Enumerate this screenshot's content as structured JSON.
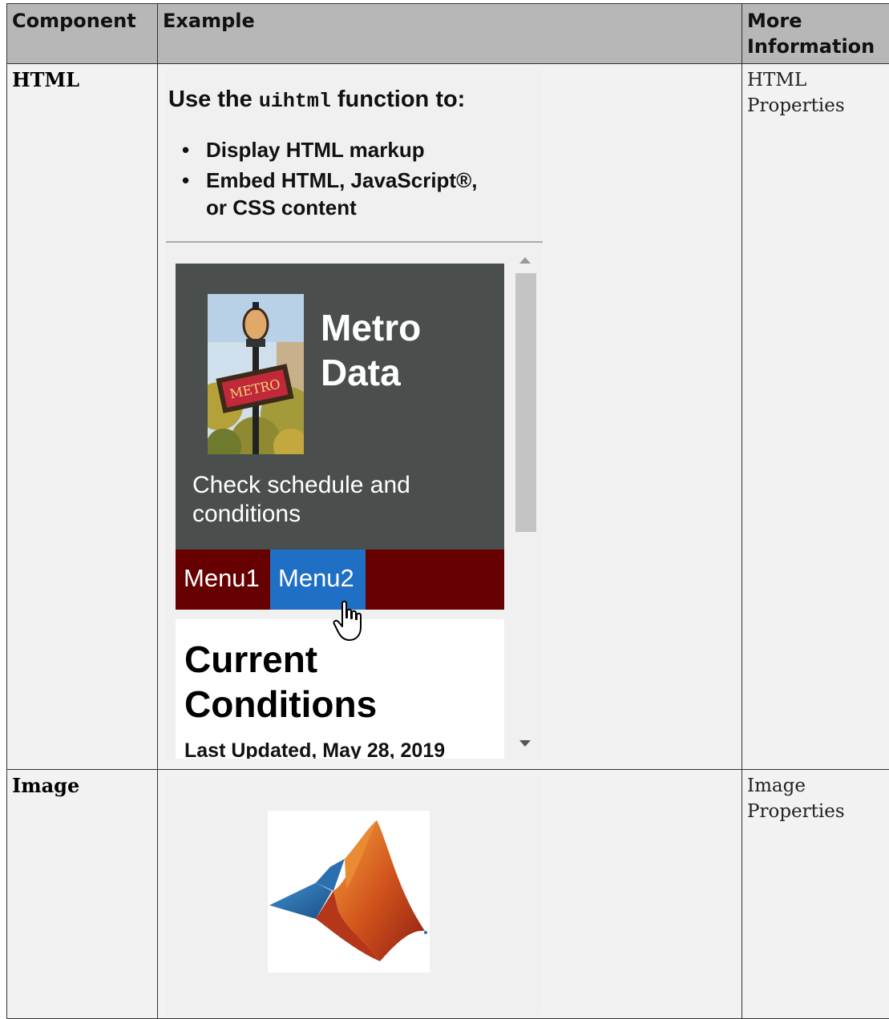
{
  "table": {
    "headers": {
      "component": "Component",
      "example": "Example",
      "more_info": "More Information"
    },
    "rows": [
      {
        "component": "HTML",
        "more_info": "HTML Properties"
      },
      {
        "component": "Image",
        "more_info": "Image Properties"
      }
    ]
  },
  "html_example": {
    "intro_prefix": "Use the ",
    "intro_code": "uihtml",
    "intro_suffix": " function to:",
    "bullet1": "Display HTML markup",
    "bullet2_line1": "Embed HTML, JavaScript®,",
    "bullet2_line2": "or CSS content",
    "app": {
      "title_line1": "Metro",
      "title_line2": "Data",
      "subtitle": "Check schedule and conditions",
      "menu1": "Menu1",
      "menu2": "Menu2",
      "content_title_line1": "Current",
      "content_title_line2": "Conditions",
      "updated": "Last Updated, May 28, 2019"
    },
    "colors": {
      "hero": "#4a4f4e",
      "menubar": "#660000",
      "menu_active": "#1f6fc5"
    },
    "icons": [
      "metro-photo",
      "hand-pointer-cursor-icon",
      "scroll-up-arrow-icon",
      "scroll-down-arrow-icon"
    ]
  },
  "image_example": {
    "icons": [
      "matlab-membrane-logo"
    ]
  }
}
